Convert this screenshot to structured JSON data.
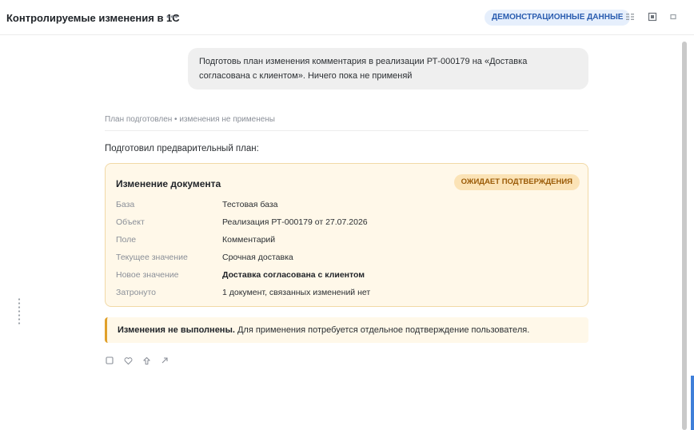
{
  "header": {
    "title": "Контролируемые изменения в 1С",
    "more_icon": "more-horizontal-icon",
    "badge": "ДЕМОНСТРАЦИОННЫЕ ДАННЫЕ",
    "icons": [
      "grid-icon",
      "panel-icon",
      "window-icon"
    ]
  },
  "chat": {
    "user_message": "Подготовь план изменения комментария в реализации РТ-000179 на «Доставка согласована с клиентом». Ничего пока не применяй",
    "status": "План подготовлен • изменения не применены",
    "intro": "Подготовил предварительный план:"
  },
  "plan": {
    "title": "Изменение документа",
    "badge": "ОЖИДАЕТ ПОДТВЕРЖДЕНИЯ",
    "rows": [
      {
        "label": "База",
        "value": "Тестовая база"
      },
      {
        "label": "Объект",
        "value": "Реализация РТ-000179 от 27.07.2026"
      },
      {
        "label": "Поле",
        "value": "Комментарий"
      },
      {
        "label": "Текущее значение",
        "value": "Срочная доставка"
      },
      {
        "label": "Новое значение",
        "value": "Доставка согласована с клиентом"
      },
      {
        "label": "Затронуто",
        "value": "1 документ, связанных изменений нет"
      }
    ]
  },
  "warning": {
    "bold": "Изменения не выполнены.",
    "text": " Для применения потребуется отдельное подтверждение пользователя."
  },
  "actions": [
    "copy-icon",
    "like-icon",
    "dislike-icon",
    "share-icon"
  ],
  "colors": {
    "accent": "#2a5db0",
    "badge_bg": "#e6effc",
    "card_bg": "#fff8e9",
    "card_border": "#f1d9a6",
    "warning_border": "#e0a02a",
    "pending_text": "#9a5a06"
  }
}
